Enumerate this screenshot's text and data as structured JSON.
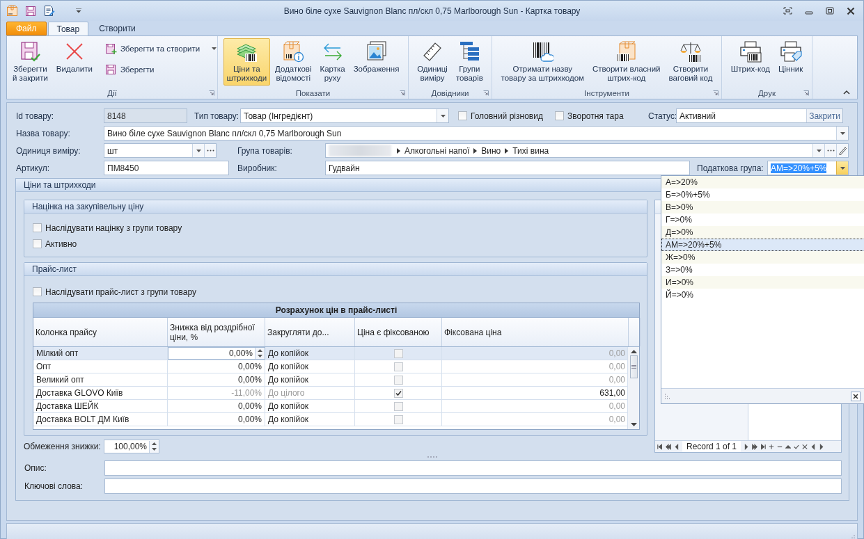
{
  "window": {
    "title": "Вино біле сухе Sauvignon Blanc пл/скл 0,75 Marlborough Sun - Картка товару"
  },
  "ribbon": {
    "tabs": [
      {
        "label": "Файл",
        "kind": "file",
        "selected": false
      },
      {
        "label": "Товар",
        "kind": "tab",
        "selected": true
      },
      {
        "label": "Створити",
        "kind": "tab",
        "selected": false
      }
    ],
    "groups": [
      {
        "label": "Дії",
        "items": [
          {
            "kind": "large",
            "lines": [
              "Зберегти",
              "й закрити"
            ],
            "selected": false
          },
          {
            "kind": "large",
            "lines": [
              "Видалити"
            ],
            "selected": false
          },
          {
            "kind": "stack",
            "entries": [
              {
                "label": "Зберегти та створити",
                "split": true
              },
              {
                "label": "Зберегти",
                "split": false
              }
            ]
          }
        ]
      },
      {
        "label": "Показати",
        "items": [
          {
            "kind": "large",
            "lines": [
              "Ціни та",
              "штрихкоди"
            ],
            "selected": true
          },
          {
            "kind": "large",
            "lines": [
              "Додаткові",
              "відомості"
            ],
            "selected": false
          },
          {
            "kind": "large",
            "lines": [
              "Картка",
              "руху"
            ],
            "selected": false
          },
          {
            "kind": "large",
            "lines": [
              "Зображення"
            ],
            "selected": false
          }
        ]
      },
      {
        "label": "Довідники",
        "items": [
          {
            "kind": "large",
            "lines": [
              "Одиниці",
              "виміру"
            ],
            "selected": false
          },
          {
            "kind": "large",
            "lines": [
              "Групи",
              "товарів"
            ],
            "selected": false
          }
        ]
      },
      {
        "label": "Інструменти",
        "items": [
          {
            "kind": "large",
            "lines": [
              "Отримати назву",
              "товару за штрихкодом"
            ],
            "selected": false
          },
          {
            "kind": "large",
            "lines": [
              "Створити власний",
              "штрих-код"
            ],
            "selected": false
          },
          {
            "kind": "large",
            "lines": [
              "Створити",
              "ваговий код"
            ],
            "selected": false
          }
        ]
      },
      {
        "label": "Друк",
        "items": [
          {
            "kind": "large",
            "lines": [
              "Штрих-код"
            ],
            "selected": false
          },
          {
            "kind": "large",
            "lines": [
              "Цінник"
            ],
            "selected": false
          }
        ]
      }
    ]
  },
  "form": {
    "id": {
      "label": "Id товару:",
      "value": "8148"
    },
    "type": {
      "label": "Тип товару:",
      "value": "Товар (Інгредієнт)"
    },
    "checkboxes": [
      {
        "label": "Головний різновид",
        "checked": false
      },
      {
        "label": "Зворотня тара",
        "checked": false
      }
    ],
    "status": {
      "label": "Статус:",
      "value": "Активний",
      "button": "Закрити"
    },
    "name": {
      "label": "Назва товару:",
      "value": "Вино біле сухе Sauvignon Blanc пл/скл 0,75 Marlborough Sun"
    },
    "unit": {
      "label": "Одиниця виміру:",
      "value": "шт"
    },
    "group": {
      "label": "Група товарів:",
      "path": [
        "Алкогольні напої",
        "Вино",
        "Тихі вина"
      ]
    },
    "article": {
      "label": "Артикул:",
      "value": "ПМ8450"
    },
    "maker": {
      "label": "Виробник:",
      "value": "Гудвайн"
    },
    "tax_group": {
      "label": "Податкова група:",
      "value": "АМ=>20%+5%",
      "open": true
    }
  },
  "prices": {
    "title": "Ціни та штрихкоди",
    "markup": {
      "title": "Націнка на закупівельну ціну",
      "checkboxes": [
        {
          "label": "Наслідувати націнку з групи товару",
          "checked": false
        },
        {
          "label": "Активно",
          "checked": false
        }
      ]
    },
    "price_list": {
      "title": "Прайс-лист",
      "inherit": {
        "label": "Наслідувати прайс-лист з групи товару",
        "checked": false
      },
      "table": {
        "title": "Розрахунок цін в прайс-листі",
        "columns": [
          "Колонка прайсу",
          "Знижка від роздрібної ціни, %",
          "Закругляти до...",
          "Ціна є фіксованою",
          "Фіксована ціна"
        ],
        "rows": [
          {
            "name": "Мілкий опт",
            "discount": "0,00%",
            "rounding": "До копійок",
            "fixed": false,
            "price": "0,00",
            "selected": true
          },
          {
            "name": "Опт",
            "discount": "0,00%",
            "rounding": "До копійок",
            "fixed": false,
            "price": "0,00",
            "selected": false
          },
          {
            "name": "Великий опт",
            "discount": "0,00%",
            "rounding": "До копійок",
            "fixed": false,
            "price": "0,00",
            "selected": false
          },
          {
            "name": "Доставка GLOVO Київ",
            "discount": "-11,00%",
            "rounding": "До цілого",
            "fixed": true,
            "price": "631,00",
            "selected": false
          },
          {
            "name": "Доставка ШЕЙК",
            "discount": "0,00%",
            "rounding": "До копійок",
            "fixed": false,
            "price": "0,00",
            "selected": false
          },
          {
            "name": "Доставка BOLT ДМ Київ",
            "discount": "0,00%",
            "rounding": "До копійок",
            "fixed": false,
            "price": "0,00",
            "selected": false
          }
        ]
      }
    },
    "discount_limit": {
      "label": "Обмеження знижки:",
      "value": "100,00%"
    },
    "navigator": {
      "text": "Record 1 of 1"
    }
  },
  "description": {
    "label": "Опис:"
  },
  "keywords": {
    "label": "Ключові слова:"
  },
  "tax_dropdown": {
    "items": [
      {
        "label": "А=>20%",
        "selected": false
      },
      {
        "label": "Б=>0%+5%",
        "selected": false
      },
      {
        "label": "В=>0%",
        "selected": false
      },
      {
        "label": "Г=>0%",
        "selected": false
      },
      {
        "label": "Д=>0%",
        "selected": false
      },
      {
        "label": "АМ=>20%+5%",
        "selected": true
      },
      {
        "label": "Ж=>0%",
        "selected": false
      },
      {
        "label": "З=>0%",
        "selected": false
      },
      {
        "label": "И=>0%",
        "selected": false
      },
      {
        "label": "Й=>0%",
        "selected": false
      }
    ]
  }
}
